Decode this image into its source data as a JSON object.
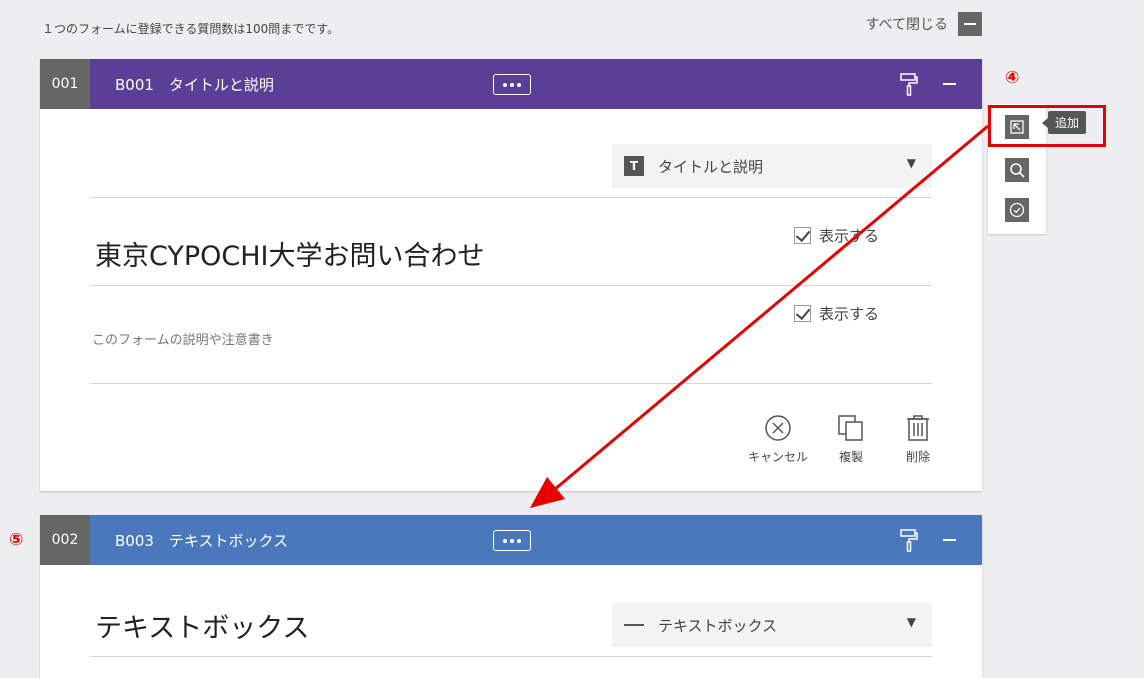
{
  "notice": "１つのフォームに登録できる質問数は100問までです。",
  "collapse_all": "すべて閉じる",
  "blocks": [
    {
      "number": "001",
      "title": "B001　タイトルと説明",
      "header_color": "#5b3f96",
      "type_label": "タイトルと説明",
      "type_icon": "T",
      "heading": "東京CYPOCHI大学お問い合わせ",
      "heading_visible_label": "表示する",
      "description_placeholder": "このフォームの説明や注意書き",
      "description_visible_label": "表示する",
      "actions": {
        "cancel": "キャンセル",
        "duplicate": "複製",
        "delete": "削除"
      }
    },
    {
      "number": "002",
      "title": "B003　テキストボックス",
      "header_color": "#4a78bd",
      "type_label": "テキストボックス",
      "heading": "テキストボックス"
    }
  ],
  "toolbar": {
    "tooltip": "追加"
  },
  "markers": {
    "step4": "④",
    "step5": "⑤"
  },
  "accent_color": "#e60000"
}
